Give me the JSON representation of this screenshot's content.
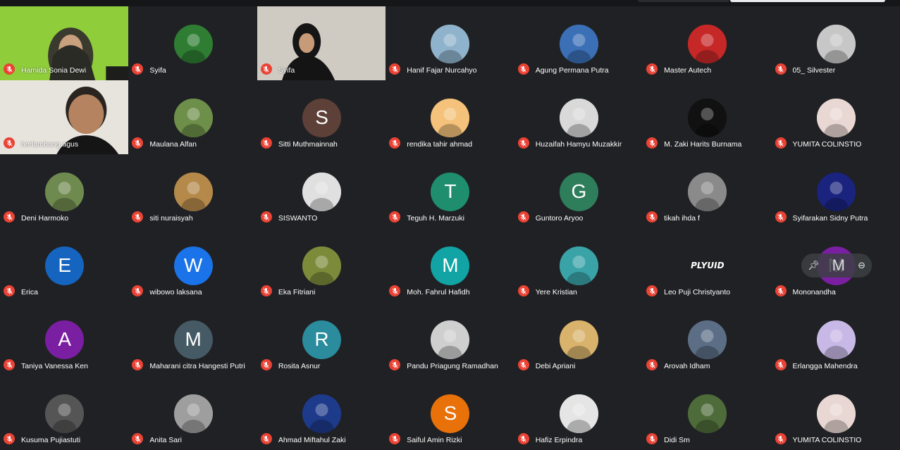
{
  "participants": [
    {
      "name": "Hamida Sonia Dewi",
      "video": "green"
    },
    {
      "name": "Syifa",
      "avatar": {
        "kind": "photo",
        "bg": "#2e7d32"
      }
    },
    {
      "name": "Syifa",
      "video": "wall"
    },
    {
      "name": "Hanif Fajar Nurcahyo",
      "avatar": {
        "kind": "photo",
        "bg": "#8fb3cc"
      }
    },
    {
      "name": "Agung Permana Putra",
      "avatar": {
        "kind": "photo",
        "bg": "#3b6fb6"
      }
    },
    {
      "name": "Master Autech",
      "avatar": {
        "kind": "photo",
        "bg": "#c62828"
      }
    },
    {
      "name": "05_ Silvester",
      "avatar": {
        "kind": "photo",
        "bg": "#c7c7c7"
      }
    },
    {
      "name": "herlambang agus",
      "video": "man"
    },
    {
      "name": "Maulana Alfan",
      "avatar": {
        "kind": "photo",
        "bg": "#6d8f4a"
      }
    },
    {
      "name": "Sitti Muthmainnah",
      "avatar": {
        "kind": "letter",
        "letter": "S",
        "bg": "#5d4037"
      }
    },
    {
      "name": "rendika tahir ahmad",
      "avatar": {
        "kind": "photo",
        "bg": "#f4c27a"
      }
    },
    {
      "name": "Huzaifah Hamyu Muzakkir",
      "avatar": {
        "kind": "photo",
        "bg": "#d9d9d9"
      }
    },
    {
      "name": "M. Zaki Harits Burnama",
      "avatar": {
        "kind": "photo",
        "bg": "#111111"
      }
    },
    {
      "name": "YUMITA COLINSTIO",
      "avatar": {
        "kind": "photo",
        "bg": "#e9d7d3"
      }
    },
    {
      "name": "Deni Harmoko",
      "avatar": {
        "kind": "photo",
        "bg": "#6f8a4f"
      }
    },
    {
      "name": "siti nuraisyah",
      "avatar": {
        "kind": "photo",
        "bg": "#b5894a"
      }
    },
    {
      "name": "SISWANTO",
      "avatar": {
        "kind": "photo",
        "bg": "#e0e0e0"
      }
    },
    {
      "name": "Teguh H. Marzuki",
      "avatar": {
        "kind": "letter",
        "letter": "T",
        "bg": "#1e8e6e"
      }
    },
    {
      "name": "Guntoro Aryoo",
      "avatar": {
        "kind": "letter",
        "letter": "G",
        "bg": "#2e7d5b"
      }
    },
    {
      "name": "tikah ihda f",
      "avatar": {
        "kind": "photo",
        "bg": "#8a8a8a"
      }
    },
    {
      "name": "Syifarakan Sidny Putra",
      "avatar": {
        "kind": "photo",
        "bg": "#1a237e"
      }
    },
    {
      "name": "Erica",
      "avatar": {
        "kind": "letter",
        "letter": "E",
        "bg": "#1565c0"
      }
    },
    {
      "name": "wibowo laksana",
      "avatar": {
        "kind": "letter",
        "letter": "W",
        "bg": "#1a73e8"
      }
    },
    {
      "name": "Eka Fitriani",
      "avatar": {
        "kind": "photo",
        "bg": "#7b8b3a"
      }
    },
    {
      "name": "Moh. Fahrul Hafidh",
      "avatar": {
        "kind": "letter",
        "letter": "M",
        "bg": "#12a4a4"
      }
    },
    {
      "name": "Yere Kristian",
      "avatar": {
        "kind": "photo",
        "bg": "#3aa3a8"
      }
    },
    {
      "name": "Leo Puji Christyanto",
      "avatar": {
        "kind": "logo",
        "logo_text": "PLYUID",
        "bg": "#202124"
      }
    },
    {
      "name": "Mononandha",
      "avatar": {
        "kind": "letter",
        "letter": "M",
        "bg": "#7b1fa2"
      }
    },
    {
      "name": "Taniya Vanessa Ken",
      "avatar": {
        "kind": "letter",
        "letter": "A",
        "bg": "#7b1fa2"
      }
    },
    {
      "name": "Maharani citra Hangesti Putri",
      "avatar": {
        "kind": "letter",
        "letter": "M",
        "bg": "#455a64"
      }
    },
    {
      "name": "Rosita Asnur",
      "avatar": {
        "kind": "letter",
        "letter": "R",
        "bg": "#2a8c9c"
      }
    },
    {
      "name": "Pandu Priagung Ramadhan",
      "avatar": {
        "kind": "photo",
        "bg": "#cfcfcf"
      }
    },
    {
      "name": "Debi Apriani",
      "avatar": {
        "kind": "photo",
        "bg": "#d9b36c"
      }
    },
    {
      "name": "Arovah Idham",
      "avatar": {
        "kind": "photo",
        "bg": "#5b6e86"
      }
    },
    {
      "name": "Erlangga Mahendra",
      "avatar": {
        "kind": "photo",
        "bg": "#c7b8e6"
      }
    },
    {
      "name": "Kusuma Pujiastuti",
      "avatar": {
        "kind": "photo",
        "bg": "#555555"
      }
    },
    {
      "name": "Anita Sari",
      "avatar": {
        "kind": "photo",
        "bg": "#9e9e9e"
      }
    },
    {
      "name": "Ahmad Miftahul Zaki",
      "avatar": {
        "kind": "photo",
        "bg": "#1e3a8a"
      }
    },
    {
      "name": "Saiful Amin Rizki",
      "avatar": {
        "kind": "letter",
        "letter": "S",
        "bg": "#e8710a"
      }
    },
    {
      "name": "Hafiz Erpindra",
      "avatar": {
        "kind": "photo",
        "bg": "#e5e5e5"
      }
    },
    {
      "name": "Didi Sm",
      "avatar": {
        "kind": "photo",
        "bg": "#4e6b3a"
      }
    },
    {
      "name": "YUMITA COLINSTIO",
      "avatar": {
        "kind": "photo",
        "bg": "#e9d7d3"
      }
    }
  ],
  "pin_overlay": {
    "pin_icon": "pin-icon",
    "letter": "M",
    "remove_icon": "remove-icon"
  },
  "icons": {
    "mic": "mic-off-icon"
  },
  "colors": {
    "background": "#202124",
    "mic_off": "#ea4335"
  }
}
